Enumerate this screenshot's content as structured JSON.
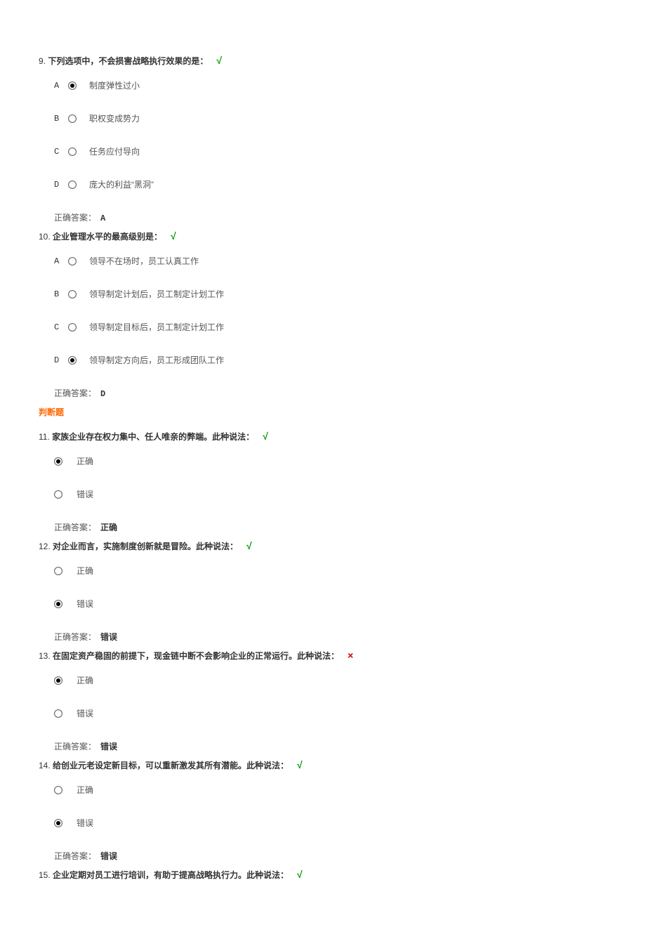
{
  "labels": {
    "answer": "正确答案：",
    "section_tf": "判断题",
    "correct_mark": "√",
    "wrong_mark": "×"
  },
  "questions": [
    {
      "num": "9.",
      "text": "下列选项中，不会损害战略执行效果的是：",
      "mark": "correct",
      "type": "mc",
      "options": [
        {
          "letter": "A",
          "text": "制度弹性过小",
          "selected": true
        },
        {
          "letter": "B",
          "text": "职权变成势力",
          "selected": false
        },
        {
          "letter": "C",
          "text": "任务应付导向",
          "selected": false
        },
        {
          "letter": "D",
          "text": "庞大的利益“黑洞”",
          "selected": false
        }
      ],
      "answer": "A"
    },
    {
      "num": "10.",
      "text": "企业管理水平的最高级别是：",
      "mark": "correct",
      "type": "mc",
      "options": [
        {
          "letter": "A",
          "text": "领导不在场时，员工认真工作",
          "selected": false
        },
        {
          "letter": "B",
          "text": "领导制定计划后，员工制定计划工作",
          "selected": false
        },
        {
          "letter": "C",
          "text": "领导制定目标后，员工制定计划工作",
          "selected": false
        },
        {
          "letter": "D",
          "text": "领导制定方向后，员工形成团队工作",
          "selected": true
        }
      ],
      "answer": "D"
    },
    {
      "num": "11.",
      "text": "家族企业存在权力集中、任人唯亲的弊端。此种说法：",
      "mark": "correct",
      "type": "tf",
      "options": [
        {
          "text": "正确",
          "selected": true
        },
        {
          "text": "错误",
          "selected": false
        }
      ],
      "answer": "正确"
    },
    {
      "num": "12.",
      "text": "对企业而言，实施制度创新就是冒险。此种说法：",
      "mark": "correct",
      "type": "tf",
      "options": [
        {
          "text": "正确",
          "selected": false
        },
        {
          "text": "错误",
          "selected": true
        }
      ],
      "answer": "错误"
    },
    {
      "num": "13.",
      "text": "在固定资产稳固的前提下，现金链中断不会影响企业的正常运行。此种说法：",
      "mark": "wrong",
      "type": "tf",
      "options": [
        {
          "text": "正确",
          "selected": true
        },
        {
          "text": "错误",
          "selected": false
        }
      ],
      "answer": "错误"
    },
    {
      "num": "14.",
      "text": "给创业元老设定新目标，可以重新激发其所有潜能。此种说法：",
      "mark": "correct",
      "type": "tf",
      "options": [
        {
          "text": "正确",
          "selected": false
        },
        {
          "text": "错误",
          "selected": true
        }
      ],
      "answer": "错误"
    },
    {
      "num": "15.",
      "text": "企业定期对员工进行培训，有助于提高战略执行力。此种说法：",
      "mark": "correct",
      "type": "tf",
      "options": [],
      "answer": null
    }
  ]
}
